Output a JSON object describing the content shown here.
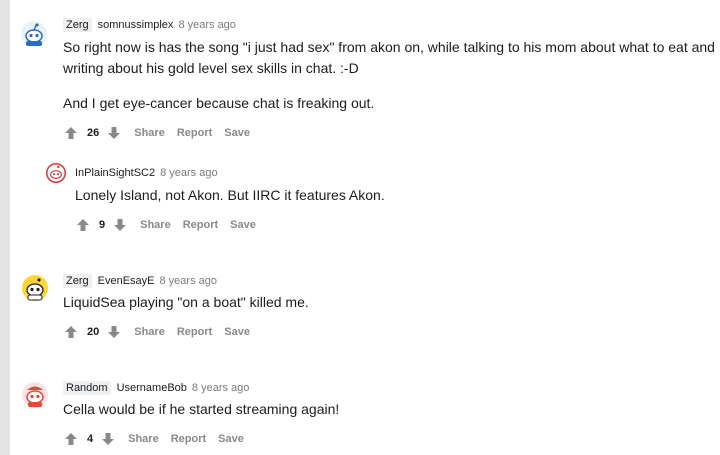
{
  "comments": [
    {
      "flair": "Zerg",
      "username": "somnussimplex",
      "time": "8 years ago",
      "paragraphs": [
        "So right now is has the song \"i just had sex\" from akon on, while talking to his mom about what to eat and writing about his gold level sex skills in chat. :-D",
        "And I get eye-cancer because chat is freaking out."
      ],
      "score": "26",
      "actions": [
        "Share",
        "Report",
        "Save"
      ]
    },
    {
      "flair": "",
      "username": "InPlainSightSC2",
      "time": "8 years ago",
      "paragraphs": [
        "Lonely Island, not Akon. But IIRC it features Akon."
      ],
      "score": "9",
      "actions": [
        "Share",
        "Report",
        "Save"
      ]
    },
    {
      "flair": "Zerg",
      "username": "EvenEsayE",
      "time": "8 years ago",
      "paragraphs": [
        "LiquidSea playing \"on a boat\" killed me."
      ],
      "score": "20",
      "actions": [
        "Share",
        "Report",
        "Save"
      ]
    },
    {
      "flair": "Random",
      "username": "UsernameBob",
      "time": "8 years ago",
      "paragraphs": [
        "Cella would be if he started streaming again!"
      ],
      "score": "4",
      "actions": [
        "Share",
        "Report",
        "Save"
      ]
    }
  ],
  "icons": {
    "upvote": "arrow-up-icon",
    "downvote": "arrow-down-icon",
    "avatar": "snoo-avatar-icon"
  },
  "colors": {
    "text": "#1c1c1c",
    "meta": "#7c7c7c",
    "action": "#878a8c",
    "flair_bg": "#edeff1",
    "thread_line": "#e3e3e3"
  }
}
